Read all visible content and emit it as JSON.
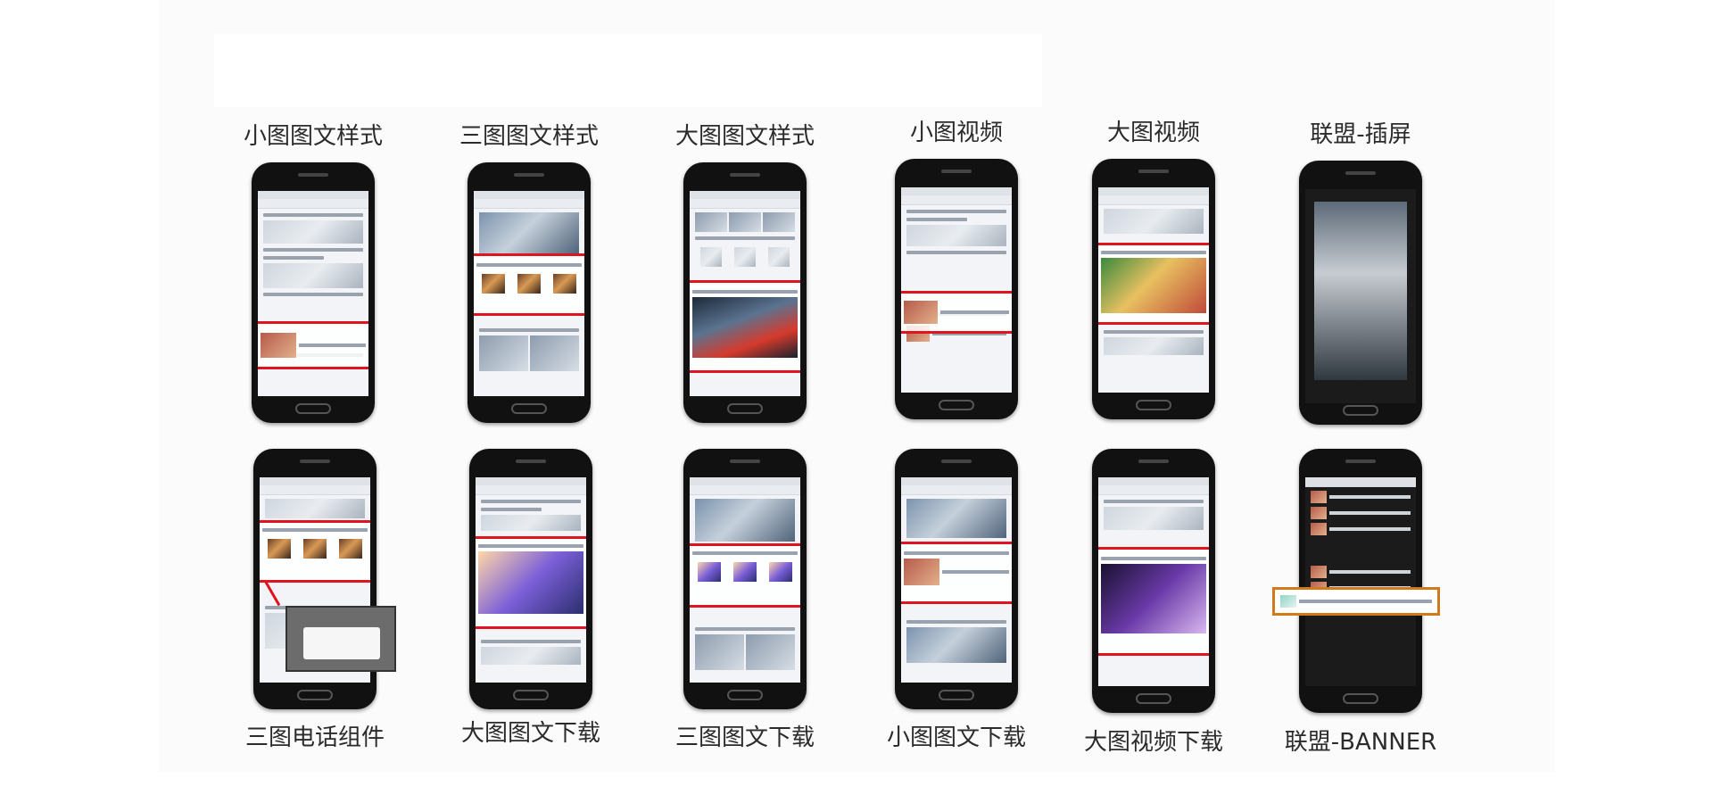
{
  "labels": {
    "top": [
      "小图图文样式",
      "三图图文样式",
      "大图图文样式",
      "小图视频",
      "大图视频",
      "联盟-插屏"
    ],
    "bottom": [
      "三图电话组件",
      "大图图文下载",
      "三图图文下载",
      "小图图文下载",
      "大图视频下载",
      "联盟-BANNER"
    ]
  },
  "colors": {
    "highlight": "#e0141e",
    "banner_highlight": "#d07a1c",
    "phone_body": "#111111"
  }
}
